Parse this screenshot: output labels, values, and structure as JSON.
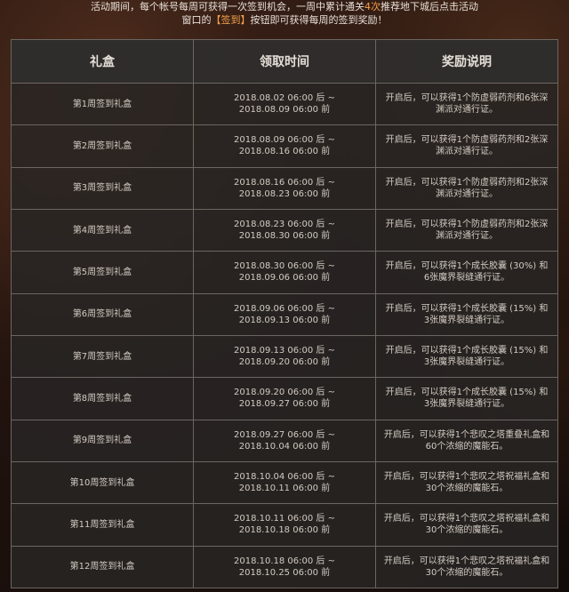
{
  "notice": {
    "line1_pre": "活动期间，每个帐号每周可获得一次签到机会，一周中累计通关",
    "line1_highlight": "4次",
    "line1_post": "推荐地下城后点击活动",
    "line2_pre": "窗口的",
    "line2_highlight": "【签到】",
    "line2_post": "按钮即可获得每周的签到奖励！"
  },
  "table": {
    "headers": [
      "礼盒",
      "领取时间",
      "奖励说明"
    ],
    "rows": [
      {
        "name": "第1周签到礼盒",
        "start": "2018.08.02 06:00 后 ~",
        "end": "2018.08.09 06:00 前",
        "reward": "开启后，可以获得1个防虚弱药剂和6张深渊派对通行证。"
      },
      {
        "name": "第2周签到礼盒",
        "start": "2018.08.09 06:00 后 ~",
        "end": "2018.08.16 06:00 前",
        "reward": "开启后，可以获得1个防虚弱药剂和2张深渊派对通行证。"
      },
      {
        "name": "第3周签到礼盒",
        "start": "2018.08.16 06:00 后 ~",
        "end": "2018.08.23 06:00 前",
        "reward": "开启后，可以获得1个防虚弱药剂和2张深渊派对通行证。"
      },
      {
        "name": "第4周签到礼盒",
        "start": "2018.08.23 06:00 后 ~",
        "end": "2018.08.30 06:00 前",
        "reward": "开启后，可以获得1个防虚弱药剂和2张深渊派对通行证。"
      },
      {
        "name": "第5周签到礼盒",
        "start": "2018.08.30 06:00 后 ~",
        "end": "2018.09.06 06:00 前",
        "reward": "开启后，可以获得1个成长胶囊 (30%) 和6张魔界裂缝通行证。"
      },
      {
        "name": "第6周签到礼盒",
        "start": "2018.09.06 06:00 后 ~",
        "end": "2018.09.13 06:00 前",
        "reward": "开启后，可以获得1个成长胶囊 (15%) 和3张魔界裂缝通行证。"
      },
      {
        "name": "第7周签到礼盒",
        "start": "2018.09.13 06:00 后 ~",
        "end": "2018.09.20 06:00 前",
        "reward": "开启后，可以获得1个成长胶囊 (15%) 和3张魔界裂缝通行证。"
      },
      {
        "name": "第8周签到礼盒",
        "start": "2018.09.20 06:00 后 ~",
        "end": "2018.09.27 06:00 前",
        "reward": "开启后，可以获得1个成长胶囊 (15%) 和3张魔界裂缝通行证。"
      },
      {
        "name": "第9周签到礼盒",
        "start": "2018.09.27 06:00 后 ~",
        "end": "2018.10.04 06:00 前",
        "reward": "开启后，可以获得1个悲叹之塔重叠礼盒和60个浓缩的魔能石。"
      },
      {
        "name": "第10周签到礼盒",
        "start": "2018.10.04 06:00 后 ~",
        "end": "2018.10.11 06:00 前",
        "reward": "开启后，可以获得1个悲叹之塔祝福礼盒和30个浓缩的魔能石。"
      },
      {
        "name": "第11周签到礼盒",
        "start": "2018.10.11 06:00 后 ~",
        "end": "2018.10.18 06:00 前",
        "reward": "开启后，可以获得1个悲叹之塔祝福礼盒和30个浓缩的魔能石。"
      },
      {
        "name": "第12周签到礼盒",
        "start": "2018.10.18 06:00 后 ~",
        "end": "2018.10.25 06:00 前",
        "reward": "开启后，可以获得1个悲叹之塔祝福礼盒和30个浓缩的魔能石。"
      }
    ]
  }
}
